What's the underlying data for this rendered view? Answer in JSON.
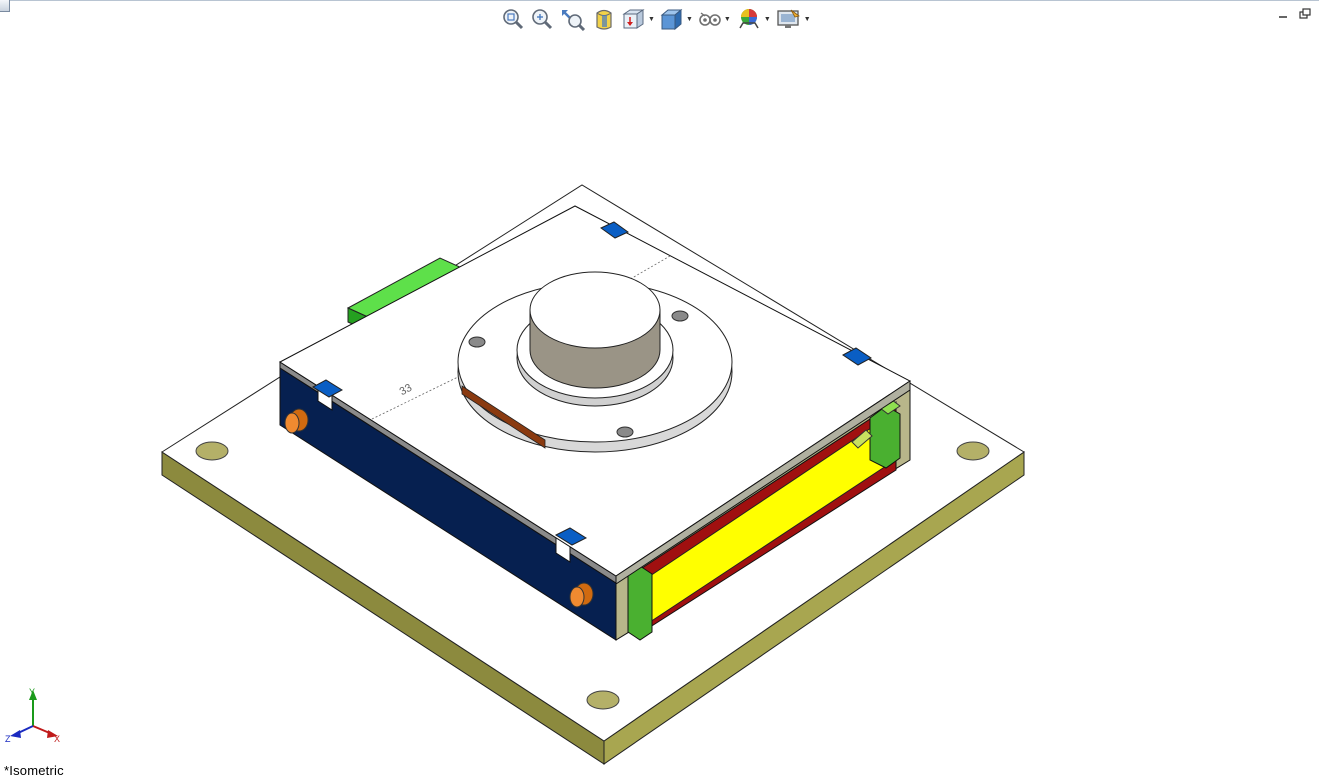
{
  "window": {
    "corner_icon": "document-tab-icon",
    "controls": [
      {
        "name": "minimize-button",
        "icon": "minimize-icon"
      },
      {
        "name": "restore-button",
        "icon": "restore-icon"
      }
    ]
  },
  "toolbar": {
    "items": [
      {
        "name": "zoom-to-fit-button",
        "icon": "zoom-to-fit-icon",
        "dropdown": false
      },
      {
        "name": "zoom-to-area-button",
        "icon": "zoom-to-area-icon",
        "dropdown": false
      },
      {
        "name": "previous-view-button",
        "icon": "previous-view-icon",
        "dropdown": false
      },
      {
        "name": "section-view-button",
        "icon": "section-view-icon",
        "dropdown": false
      },
      {
        "name": "view-orientation-button",
        "icon": "view-orientation-icon",
        "dropdown": true
      },
      {
        "name": "display-style-button",
        "icon": "display-style-icon",
        "dropdown": true
      },
      {
        "name": "hide-show-items-button",
        "icon": "hide-show-icon",
        "dropdown": true
      },
      {
        "name": "edit-appearance-button",
        "icon": "appearance-icon",
        "dropdown": true
      },
      {
        "name": "view-settings-button",
        "icon": "view-settings-icon",
        "dropdown": true
      }
    ]
  },
  "viewport": {
    "dimension_value": "33",
    "colors": {
      "base_plate_top": "#ffffff",
      "base_plate_side": "#8c8a3e",
      "housing_front": "#062050",
      "green_tab": "#33cc22",
      "blue_tabs": "#0a5ec4",
      "orange_pegs": "#d06a10",
      "yellow_panel": "#ffff00",
      "red_frame": "#a01010",
      "cylinder": "#9a9486"
    }
  },
  "triad": {
    "y": "Y",
    "x": "X",
    "z": "Z"
  },
  "view_label": "*Isometric"
}
